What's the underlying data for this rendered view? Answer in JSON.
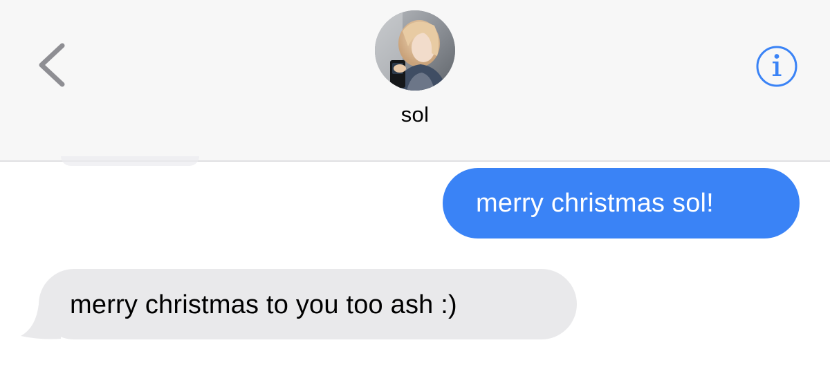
{
  "header": {
    "contact_name": "sol",
    "back_icon": "chevron-left-icon",
    "info_icon": "info-icon",
    "accent_color": "#3a83f6"
  },
  "messages": [
    {
      "direction": "sent",
      "text": "merry christmas sol!"
    },
    {
      "direction": "received",
      "text": "merry christmas to you too ash :)"
    }
  ],
  "colors": {
    "sent_bubble": "#3a83f6",
    "received_bubble": "#e9e9eb",
    "header_bg": "#f7f7f7"
  }
}
